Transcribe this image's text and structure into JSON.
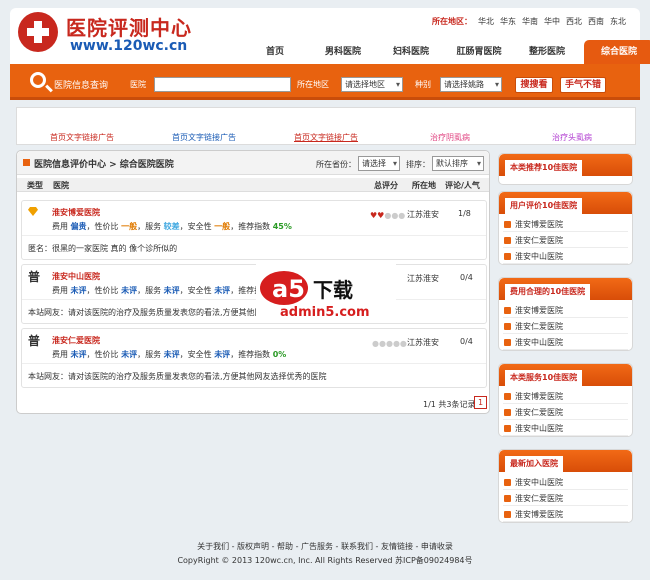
{
  "header": {
    "logo_title": "医院评测中心",
    "logo_url": "www.120wc.cn",
    "region_label": "所在地区：",
    "regions": [
      "华北",
      "华东",
      "华南",
      "华中",
      "西北",
      "西南",
      "东北"
    ],
    "nav": [
      "首页",
      "男科医院",
      "妇科医院",
      "肛肠胃医院",
      "整形医院",
      "综合医院"
    ]
  },
  "search": {
    "title": "医院信息查询",
    "hospital_label": "医院",
    "area_label": "所在地区",
    "area_value": "请选择地区",
    "type_label": "种别",
    "type_value": "请选择姚路",
    "search_btn": "搜搜看",
    "luck_btn": "手气不错"
  },
  "ads": [
    "首页文字链接广告",
    "首页文字链接广告",
    "首页文字链接广告",
    "治疗阴虱病",
    "治疗头虱病"
  ],
  "main": {
    "breadcrumb": "医院信息评价中心 > 综合医院医院",
    "province_label": "所在省份：",
    "province_value": "请选择",
    "sort_label": "排序：",
    "sort_value": "默认排序",
    "columns": [
      "类型",
      "医院",
      "总评分",
      "所在地",
      "评论/人气"
    ],
    "rows": [
      {
        "type_badge": "",
        "name": "淮安博爱医院",
        "fee_label": "费用",
        "fee": "偏贵",
        "price_label": "性价比",
        "price": "一般",
        "service_label": "服务",
        "service": "较差",
        "safety_label": "安全性",
        "safety": "一般",
        "index_label": "推荐指数",
        "index": "45%",
        "location": "江苏淮安",
        "count": "1/8",
        "comment_label": "匿名：",
        "comment": "很黑的一家医院 真的 像个诊所似的"
      },
      {
        "type_badge": "普",
        "name": "淮安中山医院",
        "fee_label": "费用",
        "fee": "未评",
        "price_label": "性价比",
        "price": "未评",
        "service_label": "服务",
        "service": "未评",
        "safety_label": "安全性",
        "safety": "未评",
        "index_label": "推荐指数",
        "index": "0%",
        "location": "江苏淮安",
        "count": "0/4",
        "comment_label": "本站网友：",
        "comment": "请对该医院的治疗及服务质量发表您的看法,方便其他网友选择优秀的医院"
      },
      {
        "type_badge": "普",
        "name": "淮安仁爱医院",
        "fee_label": "费用",
        "fee": "未评",
        "price_label": "性价比",
        "price": "未评",
        "service_label": "服务",
        "service": "未评",
        "safety_label": "安全性",
        "safety": "未评",
        "index_label": "推荐指数",
        "index": "0%",
        "location": "江苏淮安",
        "count": "0/4",
        "comment_label": "本站网友：",
        "comment": "请对该医院的治疗及服务质量发表您的看法,方便其他网友选择优秀的医院"
      }
    ],
    "pager_text": "1/1 共3条记录",
    "pager_page": "1"
  },
  "sidebar": [
    {
      "title": "本类推荐10佳医院",
      "items": []
    },
    {
      "title": "用户评价10佳医院",
      "items": [
        "淮安博爱医院",
        "淮安仁爱医院",
        "淮安中山医院"
      ]
    },
    {
      "title": "费用合理的10佳医院",
      "items": [
        "淮安博爱医院",
        "淮安仁爱医院",
        "淮安中山医院"
      ]
    },
    {
      "title": "本类服务10佳医院",
      "items": [
        "淮安博爱医院",
        "淮安仁爱医院",
        "淮安中山医院"
      ]
    },
    {
      "title": "最新加入医院",
      "items": [
        "淮安中山医院",
        "淮安仁爱医院",
        "淮安博爱医院"
      ]
    }
  ],
  "footer": {
    "links": "关于我们 - 版权声明 - 帮助 - 广告服务 - 联系我们 - 友情链接 - 申请收录",
    "copyright": "CopyRight © 2013 120wc.cn, Inc. All Rights Reserved 苏ICP备09024984号"
  },
  "watermark": {
    "brand": "a5下载",
    "domain": "admin5.com"
  },
  "colors": {
    "accent": "#e8620f",
    "brand_red": "#c8281e",
    "link_blue": "#1a5bb5"
  }
}
